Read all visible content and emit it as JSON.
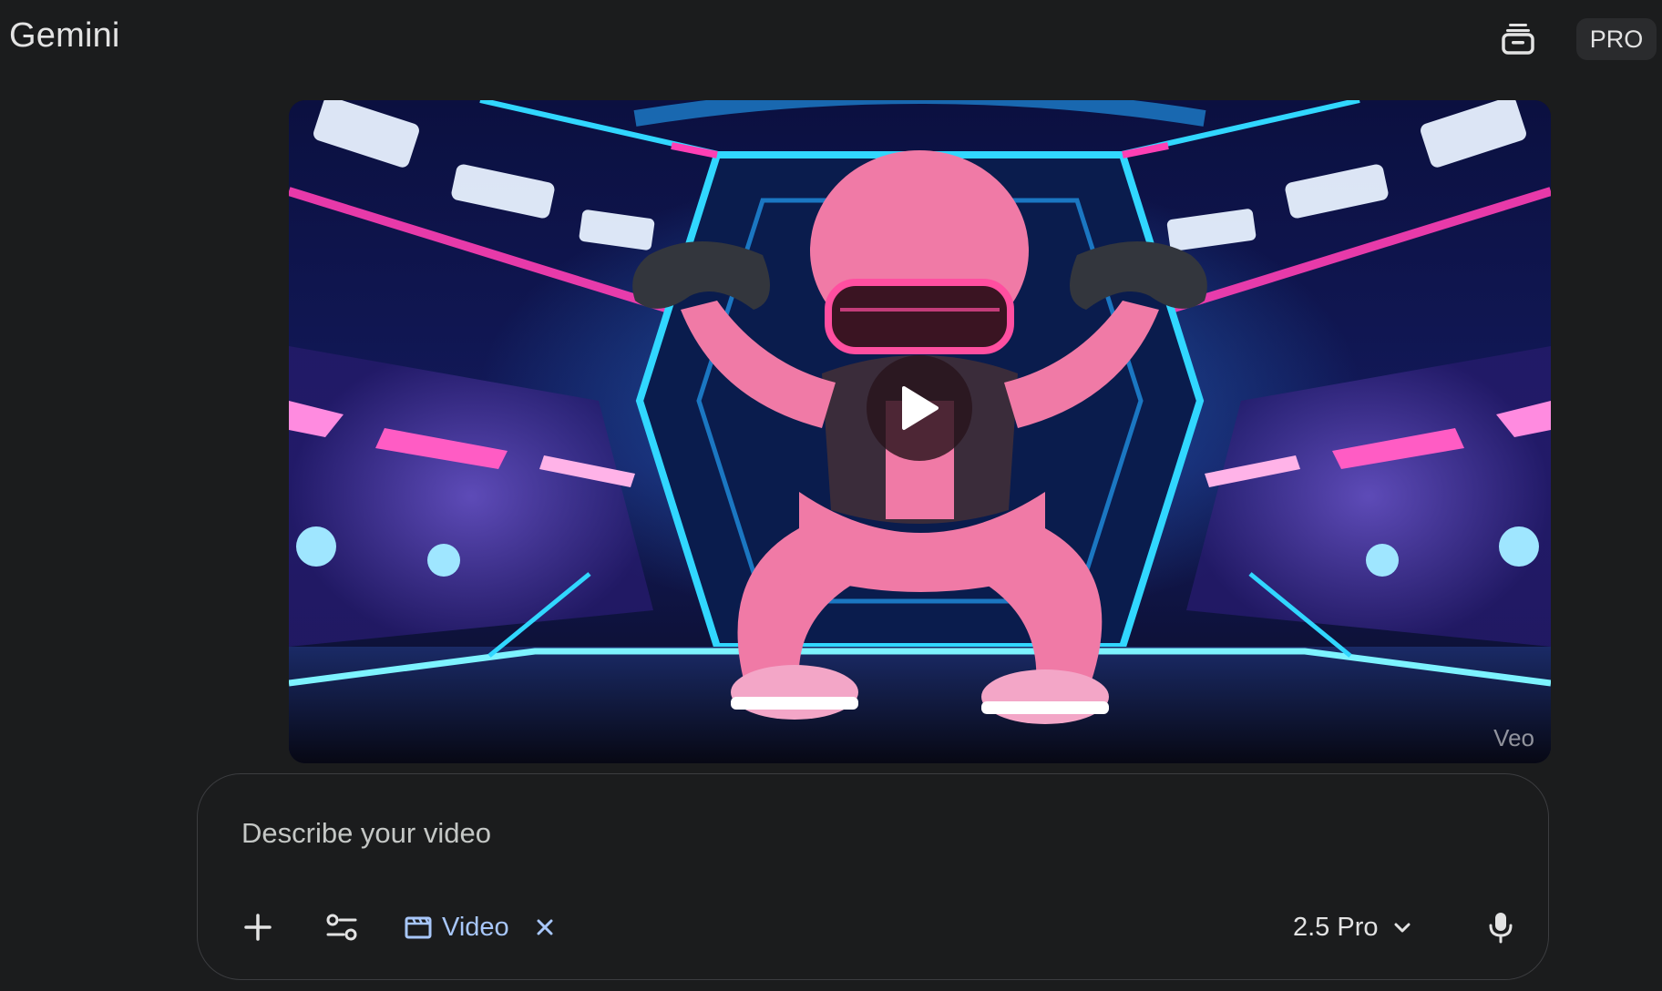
{
  "header": {
    "app_title": "Gemini",
    "temp_chat_icon": "temporary-chat-icon",
    "plan_badge": "PRO"
  },
  "video": {
    "description": "Animated pink plush character wearing a neon visor, holding two game controllers in an esports arena",
    "play_icon": "play-icon",
    "watermark": "Veo",
    "colors": {
      "pink_neon": "#ff3fb4",
      "cyan_neon": "#31d7ff",
      "character_pink": "#f07aa6"
    }
  },
  "prompt": {
    "placeholder": "Describe your video",
    "value": "",
    "add_icon": "plus-icon",
    "tools_icon": "tools-sliders-icon",
    "chip": {
      "icon": "clapperboard-icon",
      "label": "Video",
      "close_icon": "close-icon"
    },
    "model": {
      "label": "2.5 Pro",
      "icon": "chevron-down-icon"
    },
    "mic_icon": "microphone-icon"
  },
  "colors": {
    "background": "#1b1c1d",
    "chip_accent": "#a8c7fa",
    "border": "#3c3d40"
  }
}
